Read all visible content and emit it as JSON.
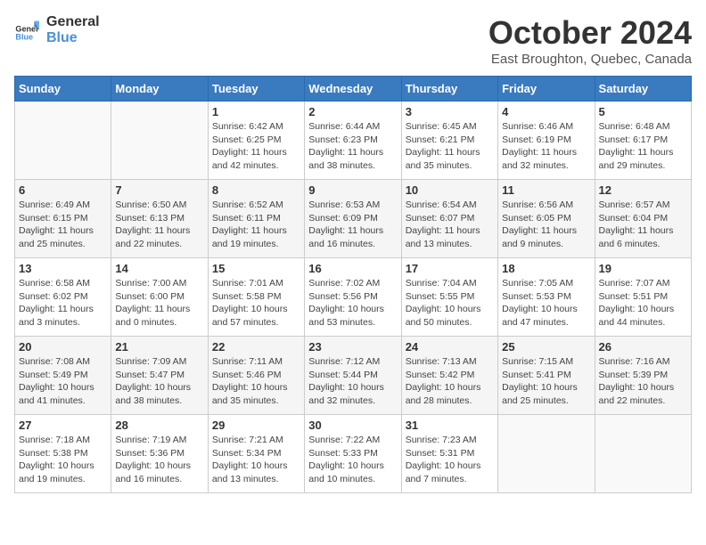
{
  "header": {
    "logo_general": "General",
    "logo_blue": "Blue",
    "month": "October 2024",
    "location": "East Broughton, Quebec, Canada"
  },
  "days_of_week": [
    "Sunday",
    "Monday",
    "Tuesday",
    "Wednesday",
    "Thursday",
    "Friday",
    "Saturday"
  ],
  "weeks": [
    [
      {
        "day": "",
        "info": ""
      },
      {
        "day": "",
        "info": ""
      },
      {
        "day": "1",
        "sunrise": "6:42 AM",
        "sunset": "6:25 PM",
        "daylight": "11 hours and 42 minutes."
      },
      {
        "day": "2",
        "sunrise": "6:44 AM",
        "sunset": "6:23 PM",
        "daylight": "11 hours and 38 minutes."
      },
      {
        "day": "3",
        "sunrise": "6:45 AM",
        "sunset": "6:21 PM",
        "daylight": "11 hours and 35 minutes."
      },
      {
        "day": "4",
        "sunrise": "6:46 AM",
        "sunset": "6:19 PM",
        "daylight": "11 hours and 32 minutes."
      },
      {
        "day": "5",
        "sunrise": "6:48 AM",
        "sunset": "6:17 PM",
        "daylight": "11 hours and 29 minutes."
      }
    ],
    [
      {
        "day": "6",
        "sunrise": "6:49 AM",
        "sunset": "6:15 PM",
        "daylight": "11 hours and 25 minutes."
      },
      {
        "day": "7",
        "sunrise": "6:50 AM",
        "sunset": "6:13 PM",
        "daylight": "11 hours and 22 minutes."
      },
      {
        "day": "8",
        "sunrise": "6:52 AM",
        "sunset": "6:11 PM",
        "daylight": "11 hours and 19 minutes."
      },
      {
        "day": "9",
        "sunrise": "6:53 AM",
        "sunset": "6:09 PM",
        "daylight": "11 hours and 16 minutes."
      },
      {
        "day": "10",
        "sunrise": "6:54 AM",
        "sunset": "6:07 PM",
        "daylight": "11 hours and 13 minutes."
      },
      {
        "day": "11",
        "sunrise": "6:56 AM",
        "sunset": "6:05 PM",
        "daylight": "11 hours and 9 minutes."
      },
      {
        "day": "12",
        "sunrise": "6:57 AM",
        "sunset": "6:04 PM",
        "daylight": "11 hours and 6 minutes."
      }
    ],
    [
      {
        "day": "13",
        "sunrise": "6:58 AM",
        "sunset": "6:02 PM",
        "daylight": "11 hours and 3 minutes."
      },
      {
        "day": "14",
        "sunrise": "7:00 AM",
        "sunset": "6:00 PM",
        "daylight": "11 hours and 0 minutes."
      },
      {
        "day": "15",
        "sunrise": "7:01 AM",
        "sunset": "5:58 PM",
        "daylight": "10 hours and 57 minutes."
      },
      {
        "day": "16",
        "sunrise": "7:02 AM",
        "sunset": "5:56 PM",
        "daylight": "10 hours and 53 minutes."
      },
      {
        "day": "17",
        "sunrise": "7:04 AM",
        "sunset": "5:55 PM",
        "daylight": "10 hours and 50 minutes."
      },
      {
        "day": "18",
        "sunrise": "7:05 AM",
        "sunset": "5:53 PM",
        "daylight": "10 hours and 47 minutes."
      },
      {
        "day": "19",
        "sunrise": "7:07 AM",
        "sunset": "5:51 PM",
        "daylight": "10 hours and 44 minutes."
      }
    ],
    [
      {
        "day": "20",
        "sunrise": "7:08 AM",
        "sunset": "5:49 PM",
        "daylight": "10 hours and 41 minutes."
      },
      {
        "day": "21",
        "sunrise": "7:09 AM",
        "sunset": "5:47 PM",
        "daylight": "10 hours and 38 minutes."
      },
      {
        "day": "22",
        "sunrise": "7:11 AM",
        "sunset": "5:46 PM",
        "daylight": "10 hours and 35 minutes."
      },
      {
        "day": "23",
        "sunrise": "7:12 AM",
        "sunset": "5:44 PM",
        "daylight": "10 hours and 32 minutes."
      },
      {
        "day": "24",
        "sunrise": "7:13 AM",
        "sunset": "5:42 PM",
        "daylight": "10 hours and 28 minutes."
      },
      {
        "day": "25",
        "sunrise": "7:15 AM",
        "sunset": "5:41 PM",
        "daylight": "10 hours and 25 minutes."
      },
      {
        "day": "26",
        "sunrise": "7:16 AM",
        "sunset": "5:39 PM",
        "daylight": "10 hours and 22 minutes."
      }
    ],
    [
      {
        "day": "27",
        "sunrise": "7:18 AM",
        "sunset": "5:38 PM",
        "daylight": "10 hours and 19 minutes."
      },
      {
        "day": "28",
        "sunrise": "7:19 AM",
        "sunset": "5:36 PM",
        "daylight": "10 hours and 16 minutes."
      },
      {
        "day": "29",
        "sunrise": "7:21 AM",
        "sunset": "5:34 PM",
        "daylight": "10 hours and 13 minutes."
      },
      {
        "day": "30",
        "sunrise": "7:22 AM",
        "sunset": "5:33 PM",
        "daylight": "10 hours and 10 minutes."
      },
      {
        "day": "31",
        "sunrise": "7:23 AM",
        "sunset": "5:31 PM",
        "daylight": "10 hours and 7 minutes."
      },
      {
        "day": "",
        "info": ""
      },
      {
        "day": "",
        "info": ""
      }
    ]
  ],
  "labels": {
    "sunrise": "Sunrise:",
    "sunset": "Sunset:",
    "daylight": "Daylight:"
  }
}
